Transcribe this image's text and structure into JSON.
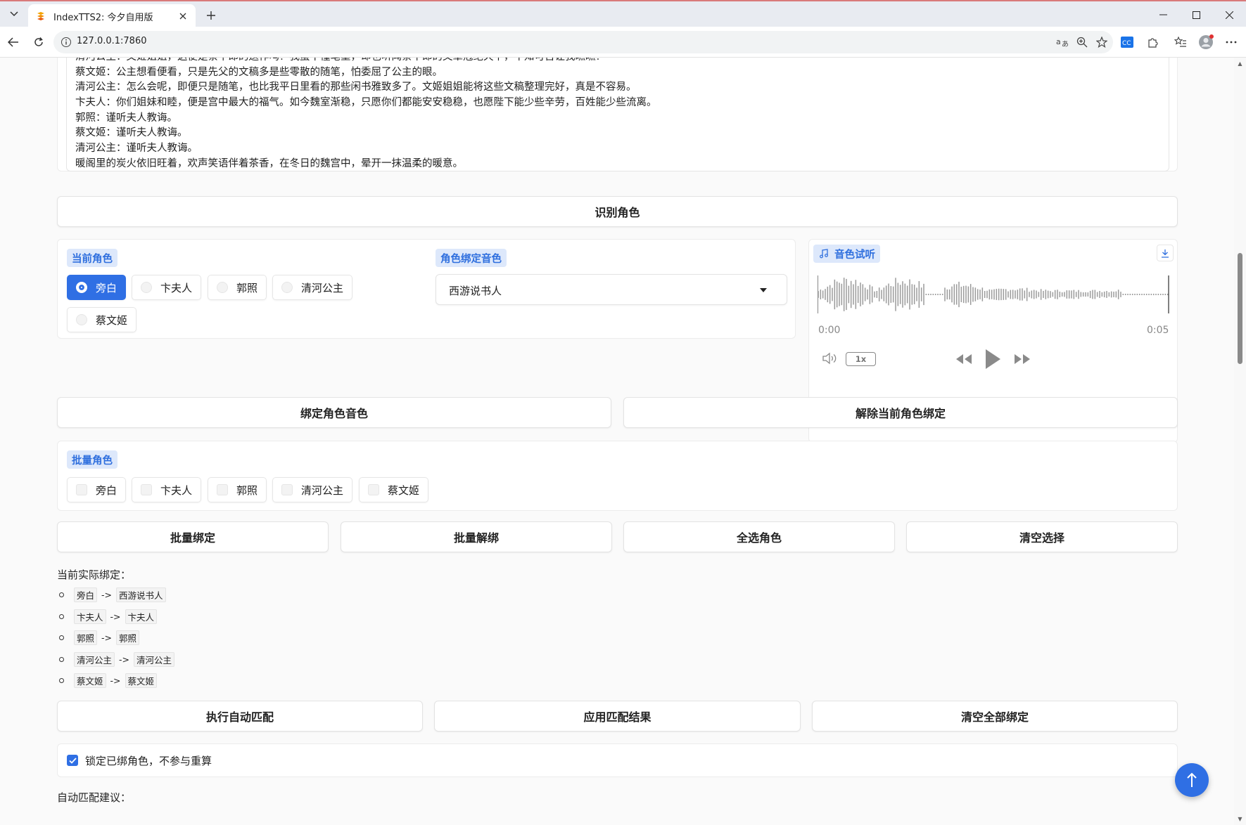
{
  "browser": {
    "tab_title": "IndexTTS2: 今夕自用版",
    "url": "127.0.0.1:7860",
    "accent_color": "#2f6fe4"
  },
  "script_text": {
    "lines": [
      "清河公主：文姬姐姐，这便是蔡中郎的遗作吗？我虽不懂笔墨，却也听闻蔡中郎的文章冠绝天下，不知可否让我瞧瞧？",
      "蔡文姬：公主想看便看，只是先父的文稿多是些零散的随笔，怕委屈了公主的眼。",
      "清河公主：怎么会呢，即便只是随笔，也比我平日里看的那些闲书雅致多了。文姬姐姐能将这些文稿整理完好，真是不容易。",
      "卞夫人：你们姐妹和睦，便是宫中最大的福气。如今魏室渐稳，只愿你们都能安安稳稳，也愿陛下能少些辛劳，百姓能少些流离。",
      "郭照：谨听夫人教诲。",
      "蔡文姬：谨听夫人教诲。",
      "清河公主：谨听夫人教诲。",
      "暖阁里的炭火依旧旺着，欢声笑语伴着茶香，在冬日的魏宫中，晕开一抹温柔的暖意。"
    ]
  },
  "buttons": {
    "identify_roles": "识别角色",
    "bind_voice": "绑定角色音色",
    "unbind_current": "解除当前角色绑定",
    "batch_bind": "批量绑定",
    "batch_unbind": "批量解绑",
    "select_all": "全选角色",
    "clear_selection": "清空选择",
    "auto_match": "执行自动匹配",
    "apply_match": "应用匹配结果",
    "clear_all_bindings": "清空全部绑定"
  },
  "current_role": {
    "label": "当前角色",
    "options": [
      "旁白",
      "卞夫人",
      "郭照",
      "清河公主",
      "蔡文姬"
    ],
    "selected": "旁白"
  },
  "voice_binding": {
    "label": "角色绑定音色",
    "value": "西游说书人"
  },
  "audio_preview": {
    "label": "音色试听",
    "current_time": "0:00",
    "duration": "0:05",
    "speed": "1x",
    "progress": 0
  },
  "batch_roles": {
    "label": "批量角色",
    "options": [
      "旁白",
      "卞夫人",
      "郭照",
      "清河公主",
      "蔡文姬"
    ]
  },
  "mapping": {
    "title": "当前实际绑定：",
    "arrow": "->",
    "items": [
      {
        "role": "旁白",
        "voice": "西游说书人"
      },
      {
        "role": "卞夫人",
        "voice": "卞夫人"
      },
      {
        "role": "郭照",
        "voice": "郭照"
      },
      {
        "role": "清河公主",
        "voice": "清河公主"
      },
      {
        "role": "蔡文姬",
        "voice": "蔡文姬"
      }
    ]
  },
  "lock_option": {
    "label": "锁定已绑角色，不参与重算",
    "checked": true
  },
  "suggestion_title": "自动匹配建议："
}
